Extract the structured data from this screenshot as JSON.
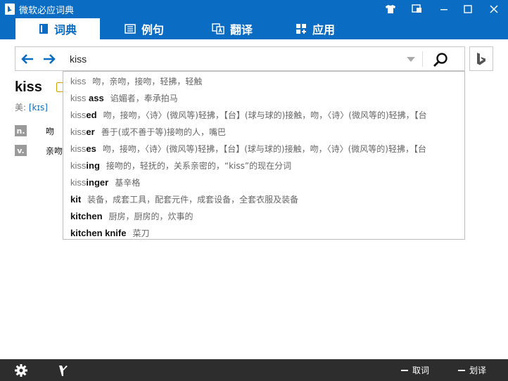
{
  "window": {
    "title": "微软必应词典"
  },
  "tabs": [
    {
      "label": "词典",
      "icon": "book-icon"
    },
    {
      "label": "例句",
      "icon": "sentences-icon"
    },
    {
      "label": "翻译",
      "icon": "translate-icon"
    },
    {
      "label": "应用",
      "icon": "apps-icon"
    }
  ],
  "search": {
    "value": "kiss"
  },
  "entry": {
    "headword": "kiss",
    "pron_label": "美:",
    "pron_value": "[kɪs]",
    "senses": [
      {
        "pos": "n.",
        "def": "吻"
      },
      {
        "pos": "v.",
        "def": "亲吻"
      }
    ]
  },
  "suggestions": [
    {
      "prefix": "kiss",
      "suffix": "",
      "bold_all": false,
      "def": "吻，亲吻，接吻，轻拂，轻触"
    },
    {
      "prefix": "kiss",
      "suffix": " ass",
      "bold_all": false,
      "def": "谄媚者，奉承拍马"
    },
    {
      "prefix": "kiss",
      "suffix": "ed",
      "bold_all": false,
      "def": "吻，接吻，〈诗〉(微风等)轻拂，【台】(球与球的)接触，吻，〈诗〉(微风等的)轻拂，【台"
    },
    {
      "prefix": "kiss",
      "suffix": "er",
      "bold_all": false,
      "def": "善于(或不善于等)接吻的人，嘴巴"
    },
    {
      "prefix": "kiss",
      "suffix": "es",
      "bold_all": false,
      "def": "吻，接吻，〈诗〉(微风等)轻拂，【台】(球与球的)接触，吻，〈诗〉(微风等的)轻拂，【台"
    },
    {
      "prefix": "kiss",
      "suffix": "ing",
      "bold_all": false,
      "def": "接吻的，轻抚的，关系亲密的，“kiss”的现在分词"
    },
    {
      "prefix": "kiss",
      "suffix": "inger",
      "bold_all": false,
      "def": "基辛格"
    },
    {
      "prefix": "kit",
      "suffix": "",
      "bold_all": true,
      "def": "装备，成套工具，配套元件，成套设备，全套衣服及装备"
    },
    {
      "prefix": "kitchen",
      "suffix": "",
      "bold_all": true,
      "def": "厨房，厨房的，炊事的"
    },
    {
      "prefix": "kitchen knife",
      "suffix": "",
      "bold_all": true,
      "def": "菜刀"
    }
  ],
  "bottom": {
    "fetch_label": "取词",
    "translate_label": "划译"
  },
  "colors": {
    "accent": "#0a6cc2",
    "bottombar": "#2d2d2d"
  }
}
